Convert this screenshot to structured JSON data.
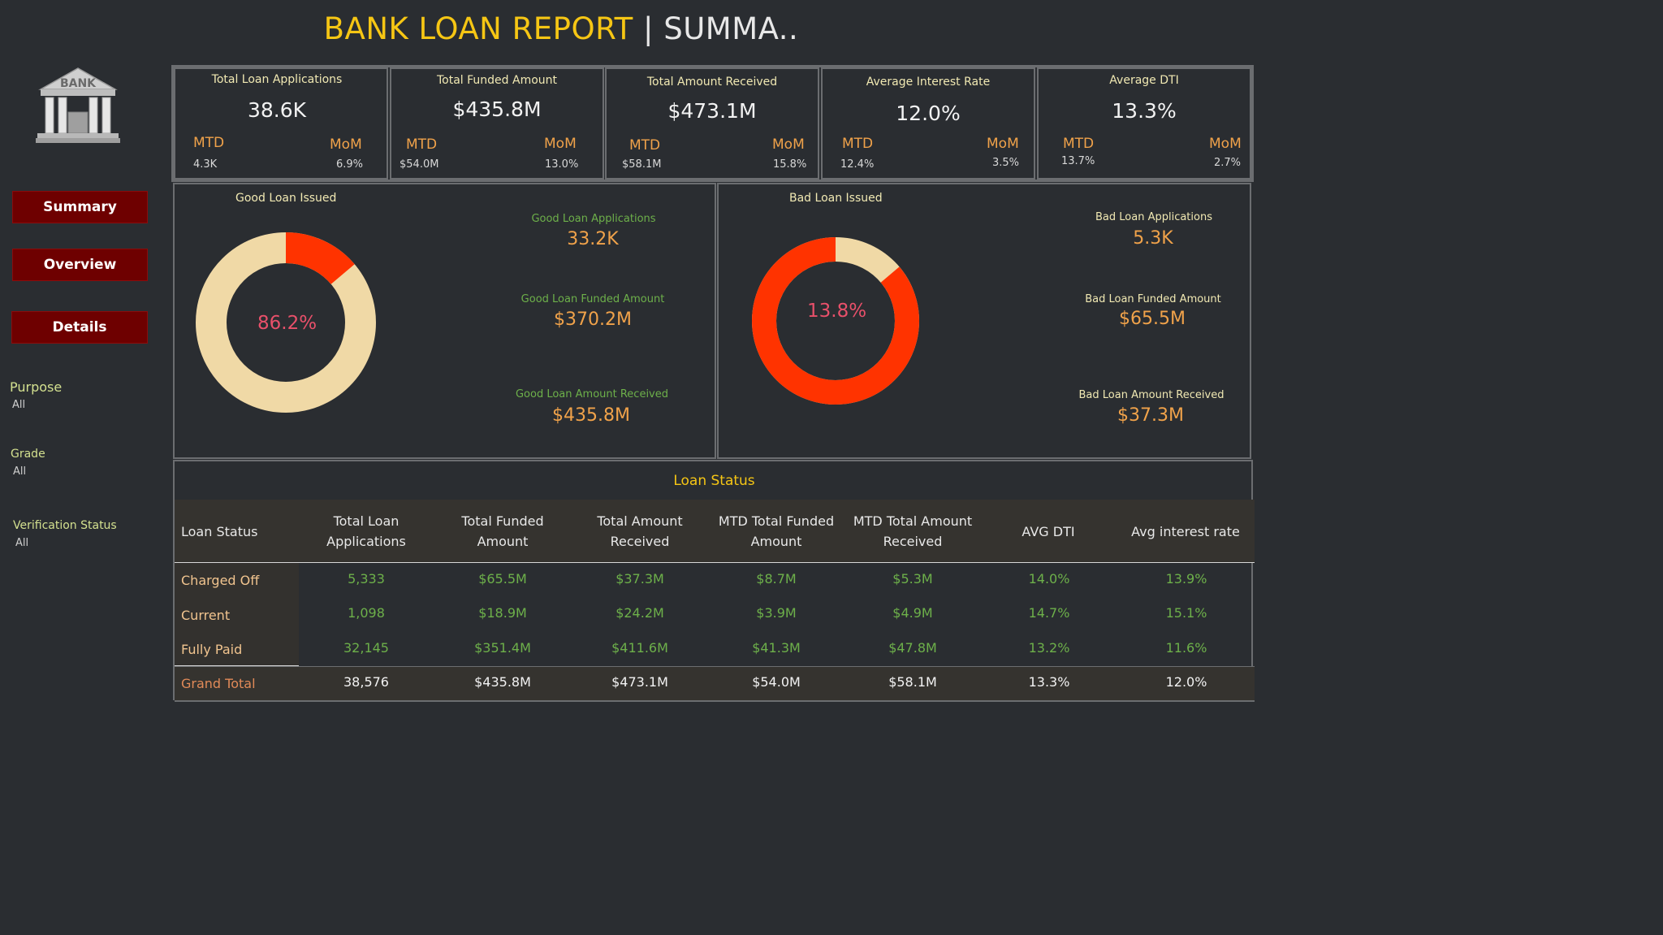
{
  "header": {
    "title_main": "BANK LOAN REPORT",
    "title_sep": " | ",
    "title_sub": "SUMMA.."
  },
  "logo": {
    "text": "BANK"
  },
  "nav": {
    "summary": "Summary",
    "overview": "Overview",
    "details": "Details"
  },
  "filters": [
    {
      "label": "Purpose",
      "value": "All"
    },
    {
      "label": "Grade",
      "value": "All"
    },
    {
      "label": "Verification Status",
      "value": "All"
    }
  ],
  "kpis": [
    {
      "title": "Total Loan Applications",
      "value": "38.6K",
      "mtd_label": "MTD",
      "mtd": "4.3K",
      "mom_label": "MoM",
      "mom": "6.9%"
    },
    {
      "title": "Total Funded Amount",
      "value": "$435.8M",
      "mtd_label": "MTD",
      "mtd": "$54.0M",
      "mom_label": "MoM",
      "mom": "13.0%"
    },
    {
      "title": "Total Amount Received",
      "value": "$473.1M",
      "mtd_label": "MTD",
      "mtd": "$58.1M",
      "mom_label": "MoM",
      "mom": "15.8%"
    },
    {
      "title": "Average Interest Rate",
      "value": "12.0%",
      "mtd_label": "MTD",
      "mtd": "12.4%",
      "mom_label": "MoM",
      "mom": "3.5%"
    },
    {
      "title": "Average DTI",
      "value": "13.3%",
      "mtd_label": "MTD",
      "mtd": "13.7%",
      "mom_label": "MoM",
      "mom": "2.7%"
    }
  ],
  "good_loan": {
    "title": "Good Loan Issued",
    "percent_label": "86.2%",
    "share": 0.862,
    "applications_label": "Good Loan Applications",
    "applications": "33.2K",
    "funded_label": "Good Loan Funded Amount",
    "funded": "$370.2M",
    "received_label": "Good Loan Amount Received",
    "received": "$435.8M"
  },
  "bad_loan": {
    "title": "Bad Loan Issued",
    "percent_label": "13.8%",
    "share": 0.138,
    "applications_label": "Bad Loan Applications",
    "applications": "5.3K",
    "funded_label": "Bad Loan Funded Amount",
    "funded": "$65.5M",
    "received_label": "Bad Loan Amount Received",
    "received": "$37.3M"
  },
  "colors": {
    "main": "#f0d9a6",
    "highlight": "#ff3300",
    "accent": "#f6c614",
    "nav": "#6e0000"
  },
  "loan_status": {
    "title": "Loan Status",
    "headers": [
      "Loan Status",
      "Total Loan Applications",
      "Total Funded Amount",
      "Total Amount Received",
      "MTD Total Funded Amount",
      "MTD Total Amount Received",
      "AVG DTI",
      "Avg interest rate"
    ],
    "rows": [
      {
        "name": "Charged Off",
        "values": [
          "5,333",
          "$65.5M",
          "$37.3M",
          "$8.7M",
          "$5.3M",
          "14.0%",
          "13.9%"
        ]
      },
      {
        "name": "Current",
        "values": [
          "1,098",
          "$18.9M",
          "$24.2M",
          "$3.9M",
          "$4.9M",
          "14.7%",
          "15.1%"
        ]
      },
      {
        "name": "Fully Paid",
        "values": [
          "32,145",
          "$351.4M",
          "$411.6M",
          "$41.3M",
          "$47.8M",
          "13.2%",
          "11.6%"
        ]
      }
    ],
    "total": {
      "name": "Grand Total",
      "values": [
        "38,576",
        "$435.8M",
        "$473.1M",
        "$54.0M",
        "$58.1M",
        "13.3%",
        "12.0%"
      ]
    }
  }
}
